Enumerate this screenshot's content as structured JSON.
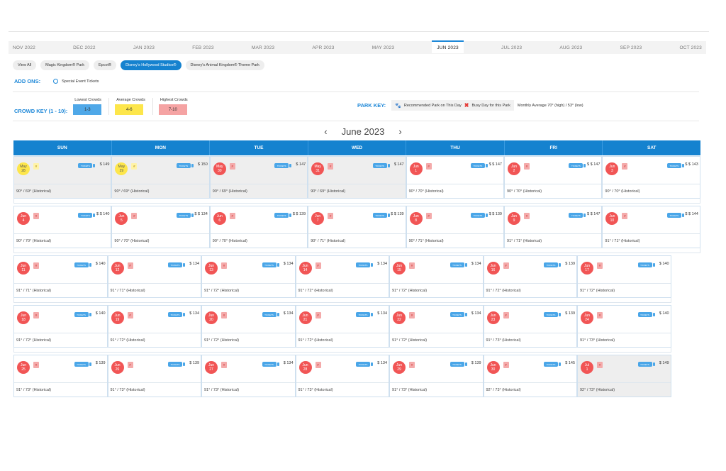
{
  "months": [
    "NOV 2022",
    "DEC 2022",
    "JAN 2023",
    "FEB 2023",
    "MAR 2023",
    "APR 2023",
    "MAY 2023",
    "JUN 2023",
    "JUL 2023",
    "AUG 2023",
    "SEP 2023",
    "OCT 2023"
  ],
  "active_month_index": 7,
  "parks": [
    "View All",
    "Magic Kingdom® Park",
    "Epcot®",
    "Disney's Hollywood Studios®",
    "Disney's Animal Kingdom® Theme Park"
  ],
  "active_park_index": 3,
  "addons": {
    "label": "ADD ONS:",
    "special": "Special Event Tickets"
  },
  "crowd_key": {
    "label": "CROWD KEY (1 - 10):",
    "items": [
      {
        "title": "Lowest Crowds",
        "range": "1-3",
        "color": "#4fa8e8"
      },
      {
        "title": "Average Crowds",
        "range": "4-6",
        "color": "#fde64b"
      },
      {
        "title": "Highest Crowds",
        "range": "7-10",
        "color": "#f5a3a3"
      }
    ]
  },
  "park_key": {
    "label": "PARK KEY:",
    "recommended": "Recommended Park on This Day",
    "busy": "Busy Day for this Park",
    "monthly": "Monthly Average 70° (high) / 53° (low)"
  },
  "calendar_title": "June 2023",
  "nav": {
    "prev": "‹",
    "next": "›"
  },
  "weekdays": [
    "SUN",
    "MON",
    "TUE",
    "WED",
    "THU",
    "FRI",
    "SAT"
  ],
  "ticket_label": "TICKETS",
  "weeks": [
    [
      {
        "m": "May",
        "d": "28",
        "price": "$ 149",
        "weather": "90° / 69° (Historical)",
        "past": true,
        "level": "yellow"
      },
      {
        "m": "May",
        "d": "29",
        "price": "$ 150",
        "weather": "90° / 69° (Historical)",
        "past": true,
        "level": "yellow"
      },
      {
        "m": "May",
        "d": "30",
        "price": "$ 147",
        "weather": "90° / 69° (Historical)",
        "past": true,
        "level": "red"
      },
      {
        "m": "May",
        "d": "31",
        "price": "$ 147",
        "weather": "90° / 69° (Historical)",
        "past": true,
        "level": "red"
      },
      {
        "m": "Jun",
        "d": "1",
        "price": "$ $ 147",
        "weather": "90° / 70° (Historical)",
        "past": false,
        "level": "red"
      },
      {
        "m": "Jun",
        "d": "2",
        "price": "$ $ 147",
        "weather": "90° / 70° (Historical)",
        "past": false,
        "level": "red"
      },
      {
        "m": "Jun",
        "d": "3",
        "price": "$ $ 143",
        "weather": "90° / 70° (Historical)",
        "past": false,
        "level": "red"
      }
    ],
    [
      {
        "m": "Jun",
        "d": "4",
        "price": "$ $ 140",
        "weather": "90° / 70° (Historical)",
        "level": "red"
      },
      {
        "m": "Jun",
        "d": "5",
        "price": "$ $ 134",
        "weather": "90° / 70° (Historical)",
        "level": "red"
      },
      {
        "m": "Jun",
        "d": "6",
        "price": "$ $ 139",
        "weather": "90° / 70° (Historical)",
        "level": "red"
      },
      {
        "m": "Jun",
        "d": "7",
        "price": "$ $ 139",
        "weather": "90° / 71° (Historical)",
        "level": "red"
      },
      {
        "m": "Jun",
        "d": "8",
        "price": "$ $ 139",
        "weather": "90° / 71° (Historical)",
        "level": "red"
      },
      {
        "m": "Jun",
        "d": "9",
        "price": "$ $ 147",
        "weather": "91° / 71° (Historical)",
        "level": "red"
      },
      {
        "m": "Jun",
        "d": "10",
        "price": "$ $ 144",
        "weather": "91° / 71° (Historical)",
        "level": "red"
      }
    ],
    [
      {
        "m": "Jun",
        "d": "11",
        "price": "$ 140",
        "weather": "91° / 71° (Historical)",
        "level": "red"
      },
      {
        "m": "Jun",
        "d": "12",
        "price": "$ 134",
        "weather": "91° / 71° (Historical)",
        "level": "red"
      },
      {
        "m": "Jun",
        "d": "13",
        "price": "$ 134",
        "weather": "91° / 72° (Historical)",
        "level": "red"
      },
      {
        "m": "Jun",
        "d": "14",
        "price": "$ 134",
        "weather": "91° / 72° (Historical)",
        "level": "red"
      },
      {
        "m": "Jun",
        "d": "15",
        "price": "$ 134",
        "weather": "91° / 72° (Historical)",
        "level": "red"
      },
      {
        "m": "Jun",
        "d": "16",
        "price": "$ 139",
        "weather": "91° / 72° (Historical)",
        "level": "red"
      },
      {
        "m": "Jun",
        "d": "17",
        "price": "$ 140",
        "weather": "91° / 72° (Historical)",
        "level": "red"
      }
    ],
    [
      {
        "m": "Jun",
        "d": "18",
        "price": "$ 140",
        "weather": "91° / 72° (Historical)",
        "level": "red"
      },
      {
        "m": "Jun",
        "d": "19",
        "price": "$ 134",
        "weather": "91° / 72° (Historical)",
        "level": "red"
      },
      {
        "m": "Jun",
        "d": "20",
        "price": "$ 134",
        "weather": "91° / 72° (Historical)",
        "level": "red"
      },
      {
        "m": "Jun",
        "d": "21",
        "price": "$ 134",
        "weather": "91° / 72° (Historical)",
        "level": "red"
      },
      {
        "m": "Jun",
        "d": "22",
        "price": "$ 134",
        "weather": "91° / 72° (Historical)",
        "level": "red"
      },
      {
        "m": "Jun",
        "d": "23",
        "price": "$ 139",
        "weather": "91° / 73° (Historical)",
        "level": "red"
      },
      {
        "m": "Jun",
        "d": "24",
        "price": "$ 140",
        "weather": "91° / 73° (Historical)",
        "level": "red"
      }
    ],
    [
      {
        "m": "Jun",
        "d": "25",
        "price": "$ 139",
        "weather": "91° / 73° (Historical)",
        "level": "red"
      },
      {
        "m": "Jun",
        "d": "26",
        "price": "$ 139",
        "weather": "91° / 73° (Historical)",
        "level": "red"
      },
      {
        "m": "Jun",
        "d": "27",
        "price": "$ 134",
        "weather": "91° / 73° (Historical)",
        "level": "red"
      },
      {
        "m": "Jun",
        "d": "28",
        "price": "$ 134",
        "weather": "91° / 73° (Historical)",
        "level": "red"
      },
      {
        "m": "Jun",
        "d": "29",
        "price": "$ 139",
        "weather": "91° / 73° (Historical)",
        "level": "red"
      },
      {
        "m": "Jun",
        "d": "30",
        "price": "$ 145",
        "weather": "92° / 73° (Historical)",
        "level": "red"
      },
      {
        "m": "Jul",
        "d": "1",
        "price": "$ 149",
        "weather": "92° / 73° (Historical)",
        "level": "red",
        "past": true
      }
    ]
  ]
}
